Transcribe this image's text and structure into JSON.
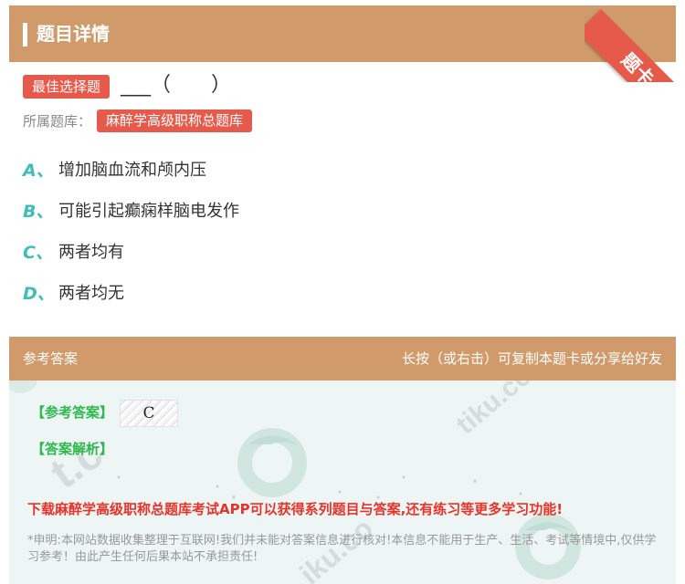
{
  "header": {
    "title": "题目详情",
    "ribbon": "题卡"
  },
  "question": {
    "type_badge": "最佳选择题",
    "stem": "___（　　）",
    "bank_label": "所属题库：",
    "bank_name": "麻醉学高级职称总题库",
    "options": [
      {
        "letter": "A、",
        "text": "增加脑血流和颅内压"
      },
      {
        "letter": "B、",
        "text": "可能引起癫痫样脑电发作"
      },
      {
        "letter": "C、",
        "text": "两者均有"
      },
      {
        "letter": "D、",
        "text": "两者均无"
      }
    ]
  },
  "answer_section": {
    "title": "参考答案",
    "hint": "长按（或右击）可复制本题卡或分享给好友",
    "answer_label": "【参考答案】",
    "answer_value": "C",
    "explanation_label": "【答案解析】",
    "promo": "下载麻醉学高级职称总题库考试APP可以获得系列题目与答案,还有练习等更多学习功能!",
    "disclaimer": "*申明:本网站数据收集整理于互联网!我们并未能对答案信息进行核对!本信息不能用于生产、生活、考试等情境中,仅供学习参考！由此产生任何后果本站不承担责任!"
  },
  "colors": {
    "header_bg": "#d09a6a",
    "accent_red": "#e65a4b",
    "option_letter": "#3fbdb8",
    "answer_green": "#2eb84e",
    "promo_red": "#e8332a",
    "answer_bg": "#edf6f4"
  }
}
